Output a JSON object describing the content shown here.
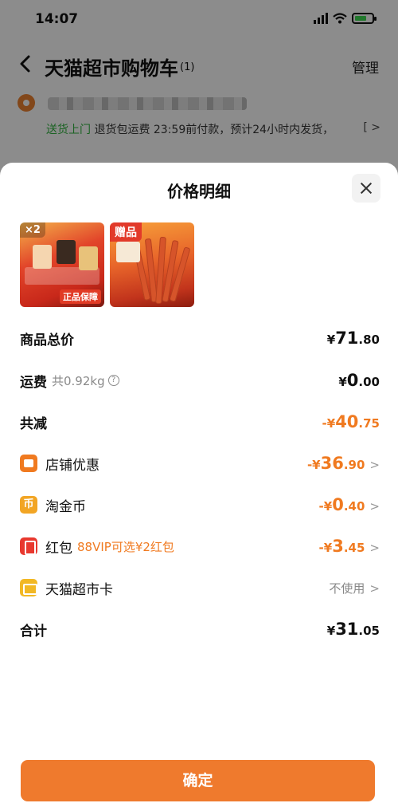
{
  "status_bar": {
    "time": "14:07"
  },
  "nav": {
    "title": "天猫超市购物车",
    "count": "(1)",
    "manage": "管理"
  },
  "shipping": {
    "tag": "送货上门",
    "text": "退货包运费 23:59前付款，预计24小时内发货，",
    "chevron": "[ >"
  },
  "sheet": {
    "title": "价格明细",
    "products": [
      {
        "badge": "×2",
        "tag": "正品保障"
      },
      {
        "badge": "赠品"
      }
    ],
    "rows": {
      "total": {
        "label": "商品总价",
        "yen": "¥",
        "int": "71",
        "dec": ".80"
      },
      "shipping": {
        "label": "运费",
        "sub": "共0.92kg",
        "help": "?",
        "yen": "¥",
        "int": "0",
        "dec": ".00"
      },
      "discount": {
        "label": "共减",
        "yen": "-¥",
        "int": "40",
        "dec": ".75"
      },
      "store": {
        "label": "店铺优惠",
        "yen": "-¥",
        "int": "36",
        "dec": ".90",
        "chevron": ">"
      },
      "coins": {
        "label": "淘金币",
        "icon_text": "币",
        "yen": "-¥",
        "int": "0",
        "dec": ".40",
        "chevron": ">"
      },
      "redpacket": {
        "label": "红包",
        "sub": "88VIP可选¥2红包",
        "yen": "-¥",
        "int": "3",
        "dec": ".45",
        "chevron": ">"
      },
      "card": {
        "label": "天猫超市卡",
        "value": "不使用",
        "chevron": ">"
      },
      "sum": {
        "label": "合计",
        "yen": "¥",
        "int": "31",
        "dec": ".05"
      }
    },
    "confirm": "确定"
  },
  "colors": {
    "accent": "#ef7a2d",
    "discount": "#f07a20",
    "green": "#2eaa3c"
  }
}
